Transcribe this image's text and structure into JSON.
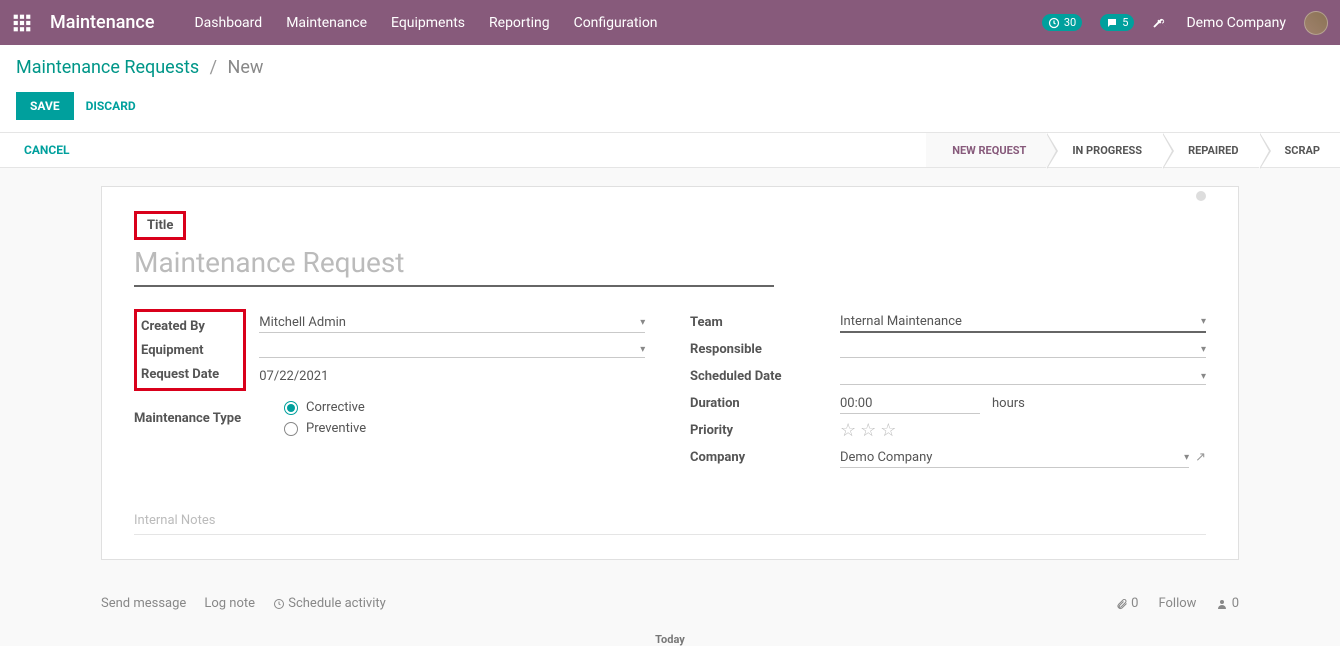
{
  "topbar": {
    "app_title": "Maintenance",
    "nav": [
      "Dashboard",
      "Maintenance",
      "Equipments",
      "Reporting",
      "Configuration"
    ],
    "badge1_count": "30",
    "badge2_count": "5",
    "company": "Demo Company"
  },
  "breadcrumb": {
    "parent": "Maintenance Requests",
    "current": "New"
  },
  "buttons": {
    "save": "SAVE",
    "discard": "DISCARD",
    "cancel": "CANCEL"
  },
  "stages": [
    "NEW REQUEST",
    "IN PROGRESS",
    "REPAIRED",
    "SCRAP"
  ],
  "form": {
    "title_label": "Title",
    "title_placeholder": "Maintenance Request",
    "labels": {
      "created_by": "Created By",
      "equipment": "Equipment",
      "request_date": "Request Date",
      "maintenance_type": "Maintenance Type",
      "team": "Team",
      "responsible": "Responsible",
      "scheduled_date": "Scheduled Date",
      "duration": "Duration",
      "priority": "Priority",
      "company": "Company"
    },
    "values": {
      "created_by": "Mitchell Admin",
      "request_date": "07/22/2021",
      "team": "Internal Maintenance",
      "duration": "00:00",
      "duration_unit": "hours",
      "company": "Demo Company"
    },
    "radio": {
      "corrective": "Corrective",
      "preventive": "Preventive"
    },
    "notes_placeholder": "Internal Notes"
  },
  "chatter": {
    "send": "Send message",
    "log": "Log note",
    "schedule": "Schedule activity",
    "attach_count": "0",
    "follow": "Follow",
    "follower_count": "0",
    "today": "Today"
  }
}
